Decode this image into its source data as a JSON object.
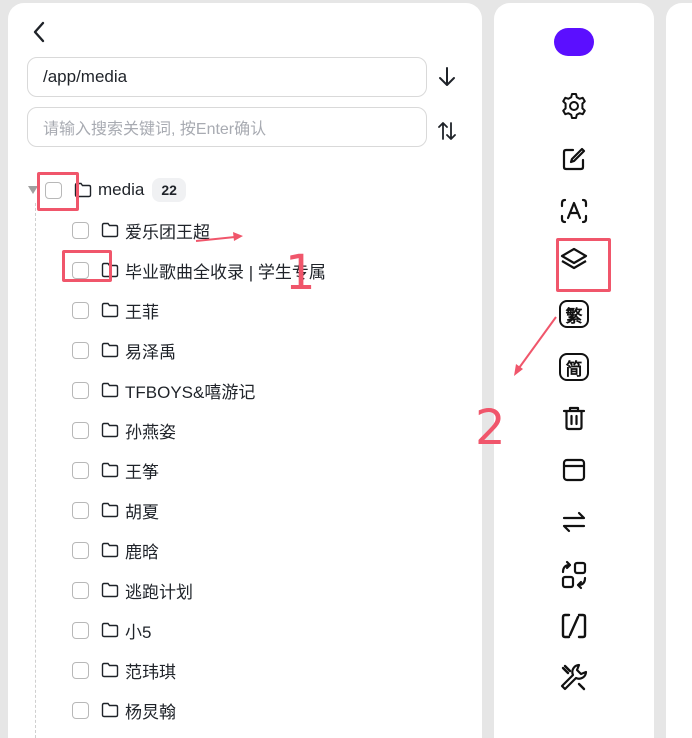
{
  "navigation": {
    "back_icon": "chevron-left-icon"
  },
  "path_field": {
    "value": "/app/media"
  },
  "search_field": {
    "placeholder": "请输入搜索关键词, 按Enter确认"
  },
  "side_actions": {
    "download_icon": "arrow-down-icon",
    "sort_icon": "sort-icon"
  },
  "tree": {
    "root": {
      "label": "media",
      "count": "22"
    },
    "children": [
      "爱乐团王超",
      "毕业歌曲全收录 | 学生专属",
      "王菲",
      "易泽禹",
      "TFBOYS&嘻游记",
      "孙燕姿",
      "王筝",
      "胡夏",
      "鹿晗",
      "逃跑计划",
      "小5",
      "范玮琪",
      "杨炅翰"
    ]
  },
  "toolbar": {
    "accent_color": "#5b0fff",
    "tools": [
      "settings-icon",
      "edit-icon",
      "font-icon",
      "layers-icon",
      "traditional-chinese-icon",
      "simplified-chinese-icon",
      "trash-icon",
      "archive-icon",
      "swap-icon",
      "rearrange-icon",
      "replace-icon",
      "wrench-icon"
    ],
    "traditional_label": "繁",
    "simplified_label": "简"
  },
  "annotations": {
    "color": "#f0566b",
    "label_1": "1",
    "label_2": "2"
  }
}
